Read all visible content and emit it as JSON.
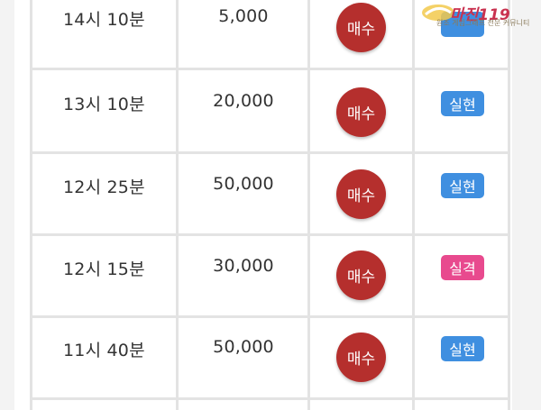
{
  "rows": [
    {
      "time": "14시 10분",
      "amount": "5,000",
      "action": "매수",
      "result": "",
      "result_color": "#3f8fe0"
    },
    {
      "time": "13시 10분",
      "amount": "20,000",
      "action": "매수",
      "result": "실현",
      "result_color": "#3f8fe0"
    },
    {
      "time": "12시 25분",
      "amount": "50,000",
      "action": "매수",
      "result": "실현",
      "result_color": "#3f8fe0"
    },
    {
      "time": "12시 15분",
      "amount": "30,000",
      "action": "매수",
      "result": "실격",
      "result_color": "#e84a8e"
    },
    {
      "time": "11시 40분",
      "amount": "50,000",
      "action": "매수",
      "result": "실현",
      "result_color": "#3f8fe0"
    }
  ],
  "watermark": {
    "name": "마진119",
    "tagline": "원조 게임그래프 전문 커뮤니티"
  },
  "colors": {
    "buy_button": "#b52f2d",
    "realized_badge": "#3f8fe0",
    "failed_badge": "#e84a8e",
    "grid": "#e3e3e3"
  }
}
